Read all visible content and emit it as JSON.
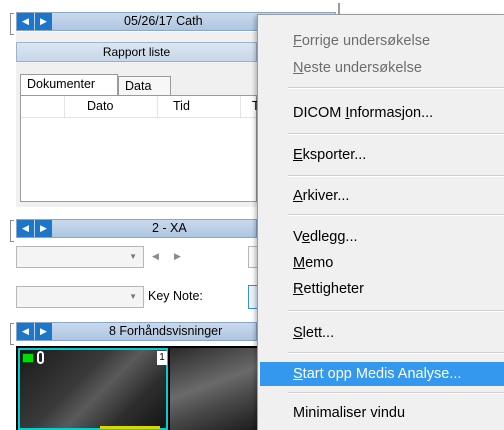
{
  "top_panel": {
    "title": "05/26/17 Cath",
    "nav_prev": "◀",
    "nav_next": "▶",
    "report_list_title": "Rapport liste",
    "tabs": [
      {
        "label": "Dokumenter",
        "active": true
      },
      {
        "label": "Data",
        "active": false
      }
    ],
    "columns": [
      "Dato",
      "Tid",
      "T"
    ]
  },
  "series_panel": {
    "title": "2 - XA",
    "nav_prev": "◀",
    "nav_next": "▶",
    "combo1_arrow": "▼",
    "small_prev": "◀",
    "small_next": "▶",
    "combo2_arrow": "▼",
    "key_note_label": "Key Note:"
  },
  "preview_panel": {
    "title": "8 Forhåndsvisninger",
    "nav_prev": "◀",
    "nav_next": "▶",
    "thumb_index": "1"
  },
  "context_menu": {
    "items": [
      {
        "pre": "",
        "u": "F",
        "post": "orrige undersøkelse",
        "disabled": true
      },
      {
        "pre": "",
        "u": "N",
        "post": "este undersøkelse",
        "disabled": true
      },
      {
        "pre": "DICOM ",
        "u": "I",
        "post": "nformasjon...",
        "disabled": false
      },
      {
        "pre": "",
        "u": "E",
        "post": "ksporter...",
        "disabled": false
      },
      {
        "pre": "",
        "u": "A",
        "post": "rkiver...",
        "disabled": false
      },
      {
        "pre": "V",
        "u": "e",
        "post": "dlegg...",
        "disabled": false
      },
      {
        "pre": "",
        "u": "M",
        "post": "emo",
        "disabled": false
      },
      {
        "pre": "",
        "u": "R",
        "post": "ettigheter",
        "disabled": false
      },
      {
        "pre": "",
        "u": "S",
        "post": "lett...",
        "disabled": false
      },
      {
        "pre": "",
        "u": "S",
        "post": "tart opp Medis Analyse...",
        "disabled": false,
        "highlighted": true
      },
      {
        "pre": "Minimaliser vindu",
        "u": "",
        "post": "",
        "disabled": false
      }
    ]
  },
  "colors": {
    "accent": "#1e76c8",
    "highlight": "#3398ee",
    "thumb_border": "#00d0d0",
    "thumb_icon": "#00e000"
  }
}
